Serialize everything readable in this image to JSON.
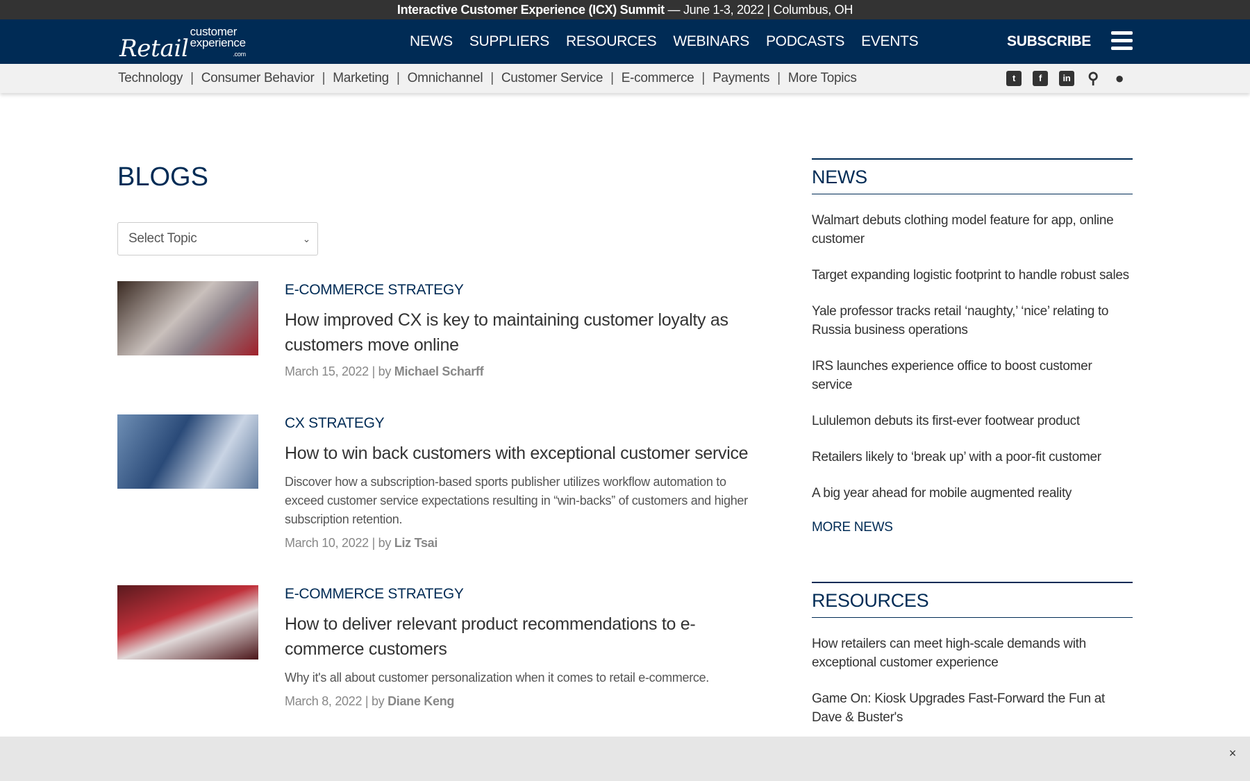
{
  "banner": {
    "event": "Interactive Customer Experience (ICX) Summit",
    "details": " — June 1-3, 2022 | Columbus, OH"
  },
  "logo": {
    "script": "Retail",
    "line1": "customer",
    "line2": "experience",
    "dotcom": ".com"
  },
  "nav": [
    "NEWS",
    "SUPPLIERS",
    "RESOURCES",
    "WEBINARS",
    "PODCASTS",
    "EVENTS"
  ],
  "subscribe": "SUBSCRIBE",
  "topics": [
    "Technology",
    "Consumer Behavior",
    "Marketing",
    "Omnichannel",
    "Customer Service",
    "E-commerce",
    "Payments",
    "More Topics"
  ],
  "social_icons": [
    "twitter-icon",
    "facebook-icon",
    "linkedin-icon",
    "search-icon",
    "user-icon"
  ],
  "page_title": "BLOGS",
  "select": {
    "value": "Select Topic"
  },
  "articles": [
    {
      "category": "E-COMMERCE STRATEGY",
      "title": "How improved CX is key to maintaining customer loyalty as customers move online",
      "description": "",
      "date": "March 15, 2022",
      "by": " | by ",
      "author": "Michael Scharff"
    },
    {
      "category": "CX STRATEGY",
      "title": "How to win back customers with exceptional customer service",
      "description": "Discover how a subscription-based sports publisher utilizes workflow automation to exceed customer service expectations resulting in “win-backs” of customers and higher subscription retention.",
      "date": "March 10, 2022",
      "by": " | by ",
      "author": "Liz Tsai"
    },
    {
      "category": "E-COMMERCE STRATEGY",
      "title": "How to deliver relevant product recommendations to e-commerce customers",
      "description": "Why it's all about customer personalization when it comes to retail e-commerce.",
      "date": "March 8, 2022",
      "by": " | by ",
      "author": "Diane Keng"
    }
  ],
  "news": {
    "heading": "NEWS",
    "items": [
      "Walmart debuts clothing model feature for app, online customer",
      "Target expanding logistic footprint to handle robust sales",
      "Yale professor tracks retail ‘naughty,’ ‘nice’ relating to Russia business operations",
      "IRS launches experience office to boost customer service",
      "Lululemon debuts its first-ever footwear product",
      "Retailers likely to ‘break up’ with a poor-fit customer",
      "A big year ahead for mobile augmented reality"
    ],
    "more": "MORE NEWS"
  },
  "resources": {
    "heading": "RESOURCES",
    "items": [
      "How retailers can meet high-scale demands with exceptional customer experience",
      "Game On: Kiosk Upgrades Fast-Forward the Fun at Dave & Buster's"
    ]
  },
  "close": "×",
  "colors": {
    "navy": "#002b55",
    "topbar": "#333333"
  }
}
